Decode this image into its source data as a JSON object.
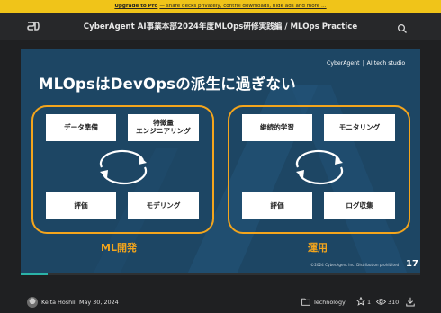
{
  "promo": {
    "link": "Upgrade to Pro",
    "text": "— share decks privately, control downloads, hide ads and more …"
  },
  "header": {
    "logo": "SD",
    "title": "CyberAgent AI事業本部2024年度MLOps研修実践編 / MLOps Practice"
  },
  "slide": {
    "brand": "CyberAgent",
    "brand_suffix": "AI tech studio",
    "title": "MLOpsはDevOpsの派生に過ぎない",
    "ml_group": {
      "label": "ML開発",
      "top_left": "データ準備",
      "top_right_line1": "特徴量",
      "top_right_line2": "エンジニアリング",
      "bottom_left": "評価",
      "bottom_right": "モデリング"
    },
    "ops_group": {
      "label": "運用",
      "top_left": "継続的学習",
      "top_right": "モニタリング",
      "bottom_left": "評価",
      "bottom_right": "ログ収集"
    },
    "copyright": "©2024 CyberAgent Inc. Distribution prohibited",
    "page_number": "17"
  },
  "progress": {
    "fraction": 0.068
  },
  "footer": {
    "author": "Keita Hoshii",
    "date": "May 30, 2024",
    "category": "Technology",
    "stars": "1",
    "views": "310"
  },
  "colors": {
    "accent": "#f4a51c",
    "slide_bg": "#1d4664",
    "progress": "#2bb3a8",
    "promo_bg": "#f0c419"
  },
  "icons": [
    "search-icon",
    "folder-icon",
    "star-icon",
    "eye-icon",
    "download-icon",
    "cycle-arrows-icon"
  ]
}
